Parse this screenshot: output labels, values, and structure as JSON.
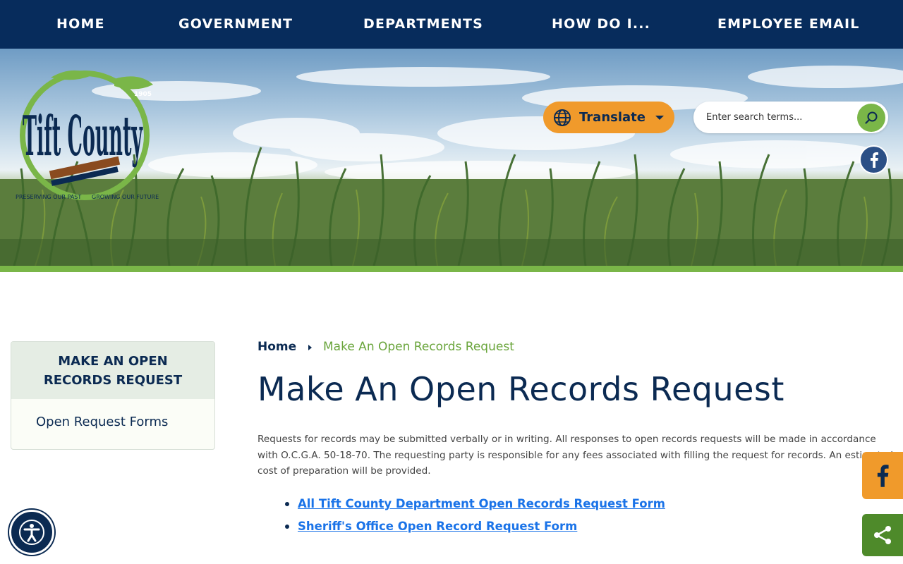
{
  "nav": {
    "items": [
      {
        "label": "HOME"
      },
      {
        "label": "GOVERNMENT"
      },
      {
        "label": "DEPARTMENTS"
      },
      {
        "label": "HOW DO I..."
      },
      {
        "label": "EMPLOYEE EMAIL"
      }
    ]
  },
  "logo": {
    "name": "Tift County",
    "year": "1905",
    "motto_left": "PRESERVING OUR PAST",
    "motto_right": "GROWING OUR FUTURE"
  },
  "translate": {
    "label": "Translate"
  },
  "search": {
    "placeholder": "Enter search terms..."
  },
  "sidebar": {
    "title": "MAKE AN OPEN RECORDS REQUEST",
    "items": [
      {
        "label": "Open Request Forms"
      }
    ]
  },
  "breadcrumb": {
    "home": "Home",
    "current": "Make An Open Records Request"
  },
  "main": {
    "title": "Make An Open Records Request",
    "intro": "Requests for records may be submitted verbally or in writing. All responses to open records requests will be made in accordance with O.C.G.A. 50-18-70. The requesting party is responsible for any fees associated with filling the request for records. An estimated cost of preparation will be provided.",
    "links": [
      {
        "label": "All Tift County Department Open Records Request Form"
      },
      {
        "label": "Sheriff's Office Open Record Request Form"
      }
    ]
  },
  "colors": {
    "navy": "#072c5c",
    "green": "#7ab648",
    "orange": "#f09a2b",
    "link": "#1a73e8"
  },
  "icons": {
    "translate": "globe-icon",
    "search": "search-icon",
    "social": "facebook-icon",
    "share": "share-icon",
    "accessibility": "accessibility-icon"
  }
}
